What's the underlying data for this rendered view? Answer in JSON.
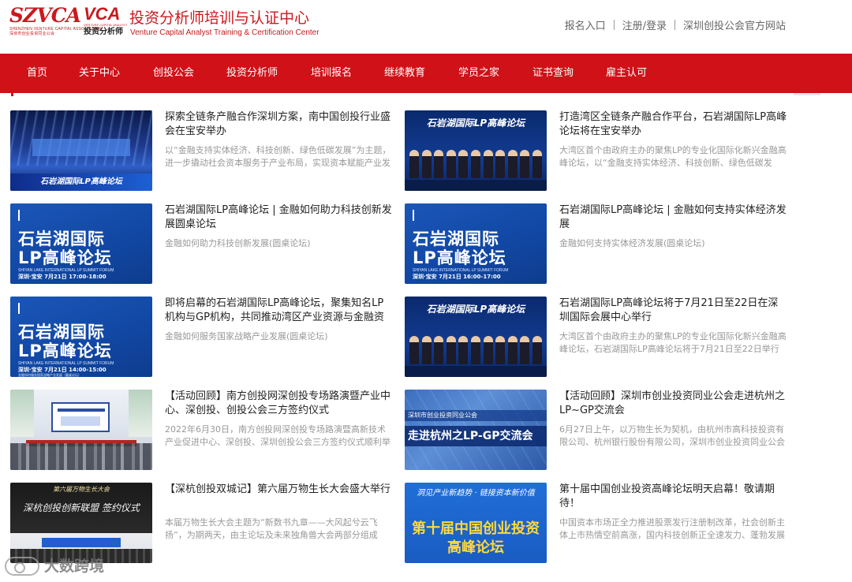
{
  "header": {
    "logo_szvca": "SZVCA",
    "logo_szvca_sub": "SHENZHEN VENTURE CAPITAL ASSOCIATION",
    "logo_szvca_cn": "深圳市创业投资同业公会",
    "logo_vca": "VCA",
    "logo_vca_sub": "VENTURE CAPITAL ANALYST",
    "logo_vca_cn": "投资分析师",
    "title": "投资分析师培训与认证中心",
    "subtitle": "Venture Capital Analyst Training & Certification Center",
    "links": [
      "报名入口",
      "注册/登录",
      "深圳创投公会官方网站"
    ]
  },
  "nav": {
    "items": [
      "首页",
      "关于中心",
      "创投公会",
      "投资分析师",
      "培训报名",
      "继续教育",
      "学员之家",
      "证书查询",
      "雇主认可"
    ],
    "active_index": 0,
    "bg_color": "#d01118"
  },
  "news": [
    {
      "title": "探索全链条产融合作深圳方案，南中国创投行业盛会在宝安举办",
      "summary": "以“金融支持实体经济、科技创新、绿色低碳发展”为主题，进一步撬动社会资本服务于产业布局，实现资本赋能产业发展",
      "thumb_text": "石岩湖国际LP高峰论坛"
    },
    {
      "title": "打造湾区全链条产融合作平台，石岩湖国际LP高峰论坛将在宝安举办",
      "summary": "大湾区首个由政府主办的聚焦LP的专业化国际化新兴金融高峰论坛，以“金融支持实体经济、科技创新、绿色低碳发展”为主题",
      "thumb_text": "石岩湖国际LP高峰论坛"
    },
    {
      "title": "石岩湖国际LP高峰论坛 | 金融如何助力科技创新发展圆桌论坛",
      "summary": "金融如何助力科技创新发展(圆桌论坛)",
      "thumb_line1": "石岩湖国际",
      "thumb_line2": "LP高峰论坛",
      "thumb_en": "SHIYAN LAKE INTERNATIONAL LP SUMMIT FORUM",
      "thumb_date": "深圳·宝安  7月21日  17:00-18:00"
    },
    {
      "title": "石岩湖国际LP高峰论坛 | 金融如何支持实体经济发展",
      "summary": "金融如何支持实体经济发展(圆桌论坛)",
      "thumb_line1": "石岩湖国际",
      "thumb_line2": "LP高峰论坛",
      "thumb_en": "SHIYAN LAKE INTERNATIONAL LP SUMMIT FORUM",
      "thumb_date": "深圳·宝安  7月21日  16:00-17:00"
    },
    {
      "title": "即将启幕的石岩湖国际LP高峰论坛，聚集知名LP机构与GP机构，共同推动湾区产业资源与金融资源对接",
      "summary": "金融如何服务国家战略产业发展(圆桌论坛)",
      "thumb_line1": "石岩湖国际",
      "thumb_line2": "LP高峰论坛",
      "thumb_en": "SHIYAN LAKE INTERNATIONAL LP SUMMIT FORUM",
      "thumb_date": "深圳·宝安  7月21日  14:00-15:00",
      "thumb_foot": "金融如何服务国家战略产业发展（圆桌论坛）"
    },
    {
      "title": "石岩湖国际LP高峰论坛将于7月21日至22日在深圳国际会展中心举行",
      "summary": "大湾区首个由政府主办的聚焦LP的专业化国际化新兴金融高峰论坛，石岩湖国际LP高峰论坛将于7月21日至22日举行",
      "thumb_text": "石岩湖国际LP高峰论坛"
    },
    {
      "title": "【活动回顾】南方创投网深创投专场路演暨产业中心、深创投、创投公会三方签约仪式",
      "summary": "2022年6月30日，南方创投网深创投专场路演暨高新技术产业促进中心、深创投、深圳创投公会三方签约仪式顺利举行"
    },
    {
      "title": "【活动回顾】深圳市创业投资同业公会走进杭州之LP~GP交流会",
      "summary": "6月27日上午，以万物生长为契机，由杭州市高科技投资有限公司、杭州银行股份有限公司，深圳市创业投资同业公会联合主办",
      "thumb_line1": "深圳市创业投资同业公会",
      "thumb_line2": "走进杭州之LP-GP交流会"
    },
    {
      "title": "【深杭创投双城记】第六届万物生长大会盛大举行",
      "summary": "本届万物生长大会主题为“新数书九章——大风起兮云飞扬”，为期两天，由主论坛及未来独角兽大会两部分组成",
      "thumb_line1": "第六届万物生长大会",
      "thumb_line2": "深杭创投创新联盟 签约仪式"
    },
    {
      "title": "第十届中国创业投资高峰论坛明天启幕！敬请期待！",
      "summary": "中国资本市场正全力推进股票发行注册制改革，社会创新主体上市热情空前高涨，国内科技创新正全速发力、蓬勃发展",
      "thumb_line1": "洞见产业新趋势 · 链接资本新价值",
      "thumb_line2": "第十届中国创业投资",
      "thumb_line3": "高峰论坛"
    }
  ],
  "watermark": {
    "text": "大数跨境"
  }
}
